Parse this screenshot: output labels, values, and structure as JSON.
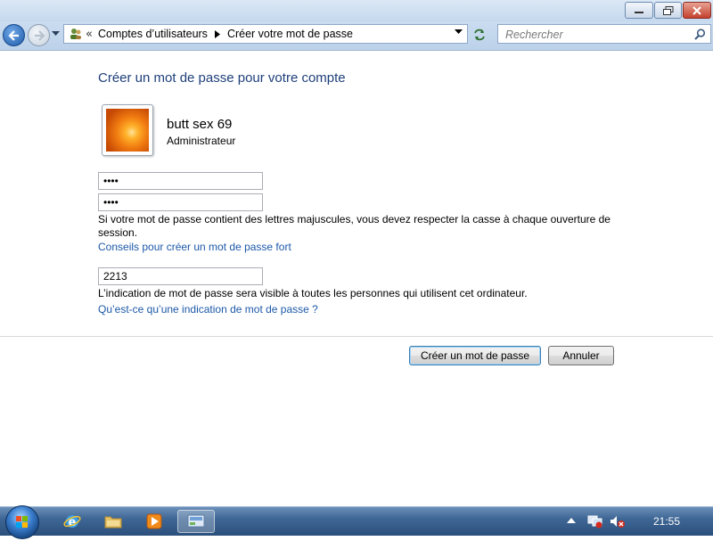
{
  "window": {
    "address": {
      "crumbs": [
        "Comptes d’utilisateurs",
        "Créer votre mot de passe"
      ]
    },
    "search": {
      "placeholder": "Rechercher"
    }
  },
  "main": {
    "title": "Créer un mot de passe pour votre compte",
    "user": {
      "name": "butt sex 69",
      "role": "Administrateur"
    },
    "password_value": "••••",
    "confirm_value": "••••",
    "case_notice": "Si votre mot de passe contient des lettres majuscules, vous devez respecter la casse à chaque ouverture de session.",
    "strong_tips_link": "Conseils pour créer un mot de passe fort",
    "hint_value": "2213",
    "hint_notice": "L’indication de mot de passe sera visible à toutes les personnes qui utilisent cet ordinateur.",
    "hint_help_link": "Qu’est-ce qu’une indication de mot de passe ?",
    "create_button": "Créer un mot de passe",
    "cancel_button": "Annuler"
  },
  "taskbar": {
    "pinned": [
      "internet-explorer-icon",
      "explorer-folder-icon",
      "media-player-icon",
      "control-panel-icon"
    ],
    "clock": "21:55"
  },
  "colors": {
    "title": "#1e3f7a",
    "link": "#1c58a8",
    "taskbar": "#3f6795"
  }
}
